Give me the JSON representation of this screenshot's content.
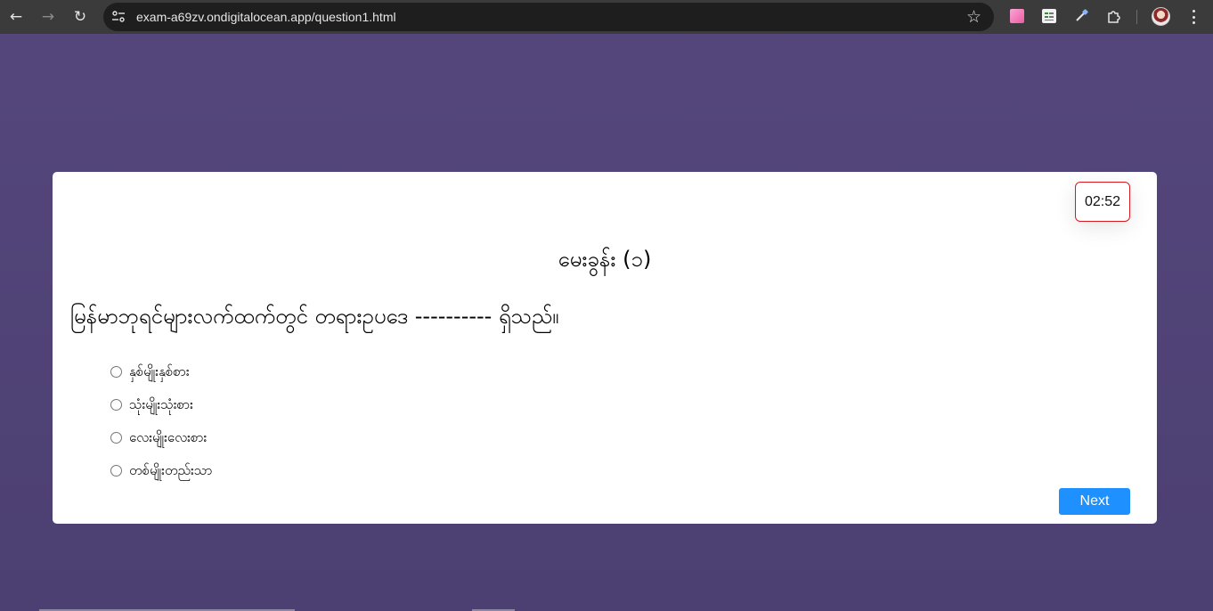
{
  "browser": {
    "url": "exam-a69zv.ondigitalocean.app/question1.html",
    "icons": {
      "back": "arrow-left-icon",
      "forward": "arrow-right-icon",
      "reload": "reload-icon",
      "site_info": "tune-icon",
      "bookmark": "star-icon",
      "menu": "more-vertical-icon"
    }
  },
  "quiz": {
    "timer": "02:52",
    "question_number": "မေးခွန်း (၁)",
    "question_text": "မြန်မာဘုရင်များလက်ထက်တွင် တရားဥပဒေ ---------- ရှိသည်။",
    "options": [
      "နှစ်မျိုးနှစ်စား",
      "သုံးမျိုးသုံးစား",
      "လေးမျိုးလေးစား",
      "တစ်မျိုးတည်းသာ"
    ],
    "next_label": "Next"
  },
  "colors": {
    "background": "#55477c",
    "timer_border": "#d9191f",
    "next_button": "#1e90ff"
  }
}
